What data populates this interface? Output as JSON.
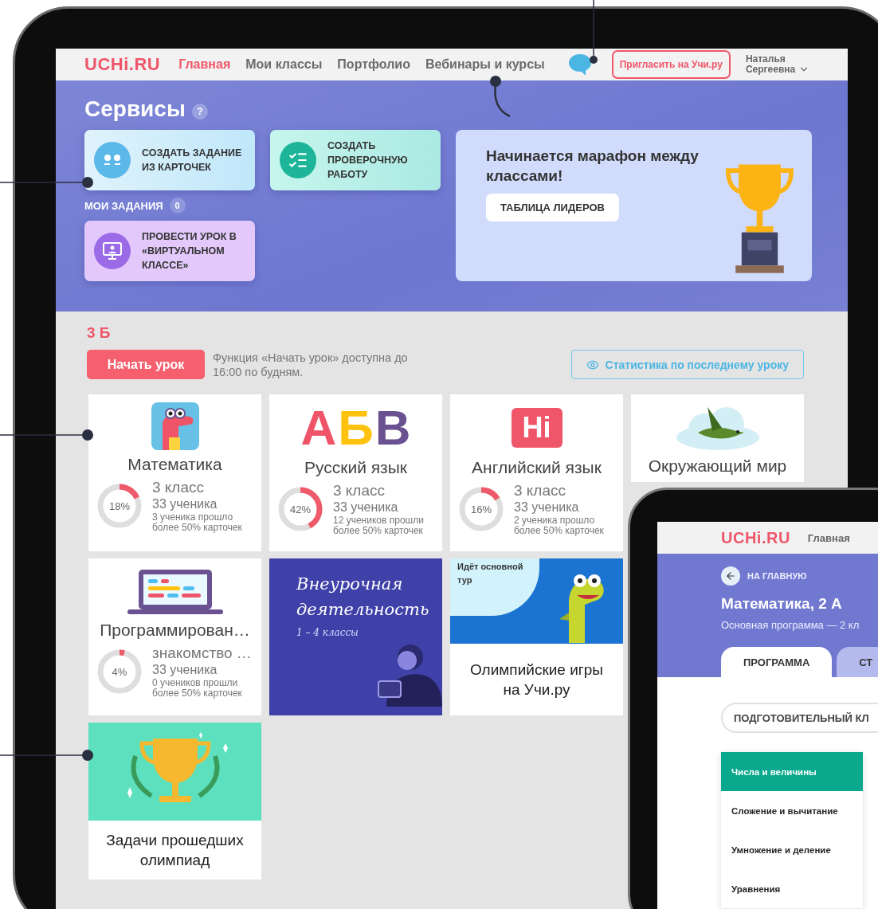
{
  "nav": {
    "logo": "UCHi.RU",
    "links": [
      {
        "label": "Главная",
        "selected": true
      },
      {
        "label": "Мои классы",
        "selected": false
      },
      {
        "label": "Портфолио",
        "selected": false
      },
      {
        "label": "Вебинары и курсы",
        "selected": false
      }
    ],
    "invite": "Пригласить на Учи.ру",
    "user": [
      "Наталья",
      "Сергеевна"
    ]
  },
  "services": {
    "title": "Сервисы",
    "help": "?",
    "actions": [
      {
        "label": "СОЗДАТЬ ЗАДАНИЕ ИЗ КАРТОЧЕК",
        "kind": "cards"
      },
      {
        "label": "СОЗДАТЬ ПРОВЕРОЧНУЮ РАБОТУ",
        "kind": "test"
      },
      {
        "label": "ПРОВЕСТИ УРОК В «ВИРТУАЛЬНОМ КЛАССЕ»",
        "kind": "virtual"
      }
    ],
    "my_tasks": {
      "label": "МОИ ЗАДАНИЯ",
      "count": "0"
    },
    "promo": {
      "title": "Начинается марафон между классами!",
      "button": "ТАБЛИЦА ЛИДЕРОВ"
    }
  },
  "class": {
    "name": "3 Б",
    "start_button": "Начать урок",
    "hint": "Функция «Начать урок» доступна до 16:00 по будням.",
    "stats_button": "Статистика по последнему уроку"
  },
  "cards": [
    {
      "kind": "subject",
      "title": "Математика",
      "grade": "3 класс",
      "students": "33 ученика",
      "note": "3 ученика прошло более 50% карточек",
      "percent": "18%",
      "level": 0.18
    },
    {
      "kind": "subject",
      "letters": [
        {
          "text": "А",
          "color": "#ef5468"
        },
        {
          "text": "Б",
          "color": "#ffc20e"
        },
        {
          "text": "В",
          "color": "#6a5191"
        }
      ],
      "title": "Русский язык",
      "grade": "3 класс",
      "students": "33 ученика",
      "note": "12 учеников прошли более 50% карточек",
      "percent": "42%",
      "level": 0.42
    },
    {
      "kind": "subject",
      "badge": "Hi",
      "title": "Английский язык",
      "grade": "3 класс",
      "students": "33 ученика",
      "note": "2 ученика прошло более 50% карточек",
      "percent": "16%",
      "level": 0.16
    },
    {
      "kind": "subject",
      "title": "Окружающий мир"
    },
    {
      "kind": "subject",
      "title": "Программирован…",
      "grade": "знакомство …",
      "students": "33 ученика",
      "note": "0 учеников прошли более 50% карточек",
      "percent": "4%",
      "level": 0.04
    },
    {
      "kind": "extracurricular",
      "heading": "Внеурочная деятельность",
      "subheading": "1 – 4 классы"
    },
    {
      "kind": "olympiad",
      "bubble": "Идёт основной тур",
      "caption": "Олимпийские игры на Учи.ру"
    },
    {
      "kind": "trophy",
      "caption": "Задачи прошедших олимпиад"
    }
  ],
  "preview": {
    "logo": "UCHi.RU",
    "nav_link": "Главная",
    "back": "НА ГЛАВНУЮ",
    "title": "Математика, 2 А",
    "subtitle": "Основная программа — 2 кл",
    "tabs": [
      {
        "label": "ПРОГРАММА",
        "selected": true
      },
      {
        "label": "СТ",
        "selected": false
      }
    ],
    "grade_filter": "ПОДГОТОВИТЕЛЬНЫЙ КЛ",
    "topics": [
      {
        "label": "Числа и величины",
        "selected": true
      },
      {
        "label": "Сложение и вычитание",
        "selected": false
      },
      {
        "label": "Умножение и деление",
        "selected": false
      },
      {
        "label": "Уравнения",
        "selected": false
      }
    ]
  }
}
